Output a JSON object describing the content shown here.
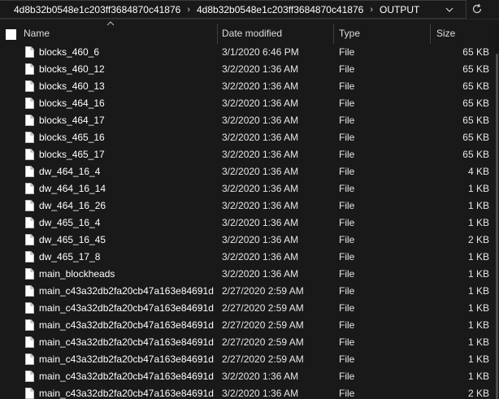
{
  "breadcrumb": {
    "items": [
      "4d8b32b0548e1c203ff3684870c41876",
      "4d8b32b0548e1c203ff3684870c41876",
      "OUTPUT"
    ],
    "separator": "›"
  },
  "columns": {
    "name": "Name",
    "date": "Date modified",
    "type": "Type",
    "size": "Size"
  },
  "files": [
    {
      "name": "blocks_460_6",
      "date": "3/1/2020 6:46 PM",
      "type": "File",
      "size": "65 KB"
    },
    {
      "name": "blocks_460_12",
      "date": "3/2/2020 1:36 AM",
      "type": "File",
      "size": "65 KB"
    },
    {
      "name": "blocks_460_13",
      "date": "3/2/2020 1:36 AM",
      "type": "File",
      "size": "65 KB"
    },
    {
      "name": "blocks_464_16",
      "date": "3/2/2020 1:36 AM",
      "type": "File",
      "size": "65 KB"
    },
    {
      "name": "blocks_464_17",
      "date": "3/2/2020 1:36 AM",
      "type": "File",
      "size": "65 KB"
    },
    {
      "name": "blocks_465_16",
      "date": "3/2/2020 1:36 AM",
      "type": "File",
      "size": "65 KB"
    },
    {
      "name": "blocks_465_17",
      "date": "3/2/2020 1:36 AM",
      "type": "File",
      "size": "65 KB"
    },
    {
      "name": "dw_464_16_4",
      "date": "3/2/2020 1:36 AM",
      "type": "File",
      "size": "4 KB"
    },
    {
      "name": "dw_464_16_14",
      "date": "3/2/2020 1:36 AM",
      "type": "File",
      "size": "1 KB"
    },
    {
      "name": "dw_464_16_26",
      "date": "3/2/2020 1:36 AM",
      "type": "File",
      "size": "1 KB"
    },
    {
      "name": "dw_465_16_4",
      "date": "3/2/2020 1:36 AM",
      "type": "File",
      "size": "1 KB"
    },
    {
      "name": "dw_465_16_45",
      "date": "3/2/2020 1:36 AM",
      "type": "File",
      "size": "2 KB"
    },
    {
      "name": "dw_465_17_8",
      "date": "3/2/2020 1:36 AM",
      "type": "File",
      "size": "1 KB"
    },
    {
      "name": "main_blockheads",
      "date": "3/2/2020 1:36 AM",
      "type": "File",
      "size": "1 KB"
    },
    {
      "name": "main_c43a32db2fa20cb47a163e84691d...",
      "date": "2/27/2020 2:59 AM",
      "type": "File",
      "size": "1 KB"
    },
    {
      "name": "main_c43a32db2fa20cb47a163e84691d...",
      "date": "2/27/2020 2:59 AM",
      "type": "File",
      "size": "1 KB"
    },
    {
      "name": "main_c43a32db2fa20cb47a163e84691d...",
      "date": "2/27/2020 2:59 AM",
      "type": "File",
      "size": "1 KB"
    },
    {
      "name": "main_c43a32db2fa20cb47a163e84691d...",
      "date": "2/27/2020 2:59 AM",
      "type": "File",
      "size": "1 KB"
    },
    {
      "name": "main_c43a32db2fa20cb47a163e84691d...",
      "date": "2/27/2020 2:59 AM",
      "type": "File",
      "size": "1 KB"
    },
    {
      "name": "main_c43a32db2fa20cb47a163e84691d...",
      "date": "3/2/2020 1:36 AM",
      "type": "File",
      "size": "1 KB"
    },
    {
      "name": "main_c43a32db2fa20cb47a163e84691d...",
      "date": "3/2/2020 1:36 AM",
      "type": "File",
      "size": "2 KB"
    }
  ],
  "icons": {
    "file": "file-icon",
    "refresh": "refresh-icon",
    "dropdown": "chevron-down-icon",
    "sort": "sort-up-icon"
  },
  "colors": {
    "background": "#191919",
    "text": "#ffffff",
    "divider": "#3f3f3f"
  }
}
